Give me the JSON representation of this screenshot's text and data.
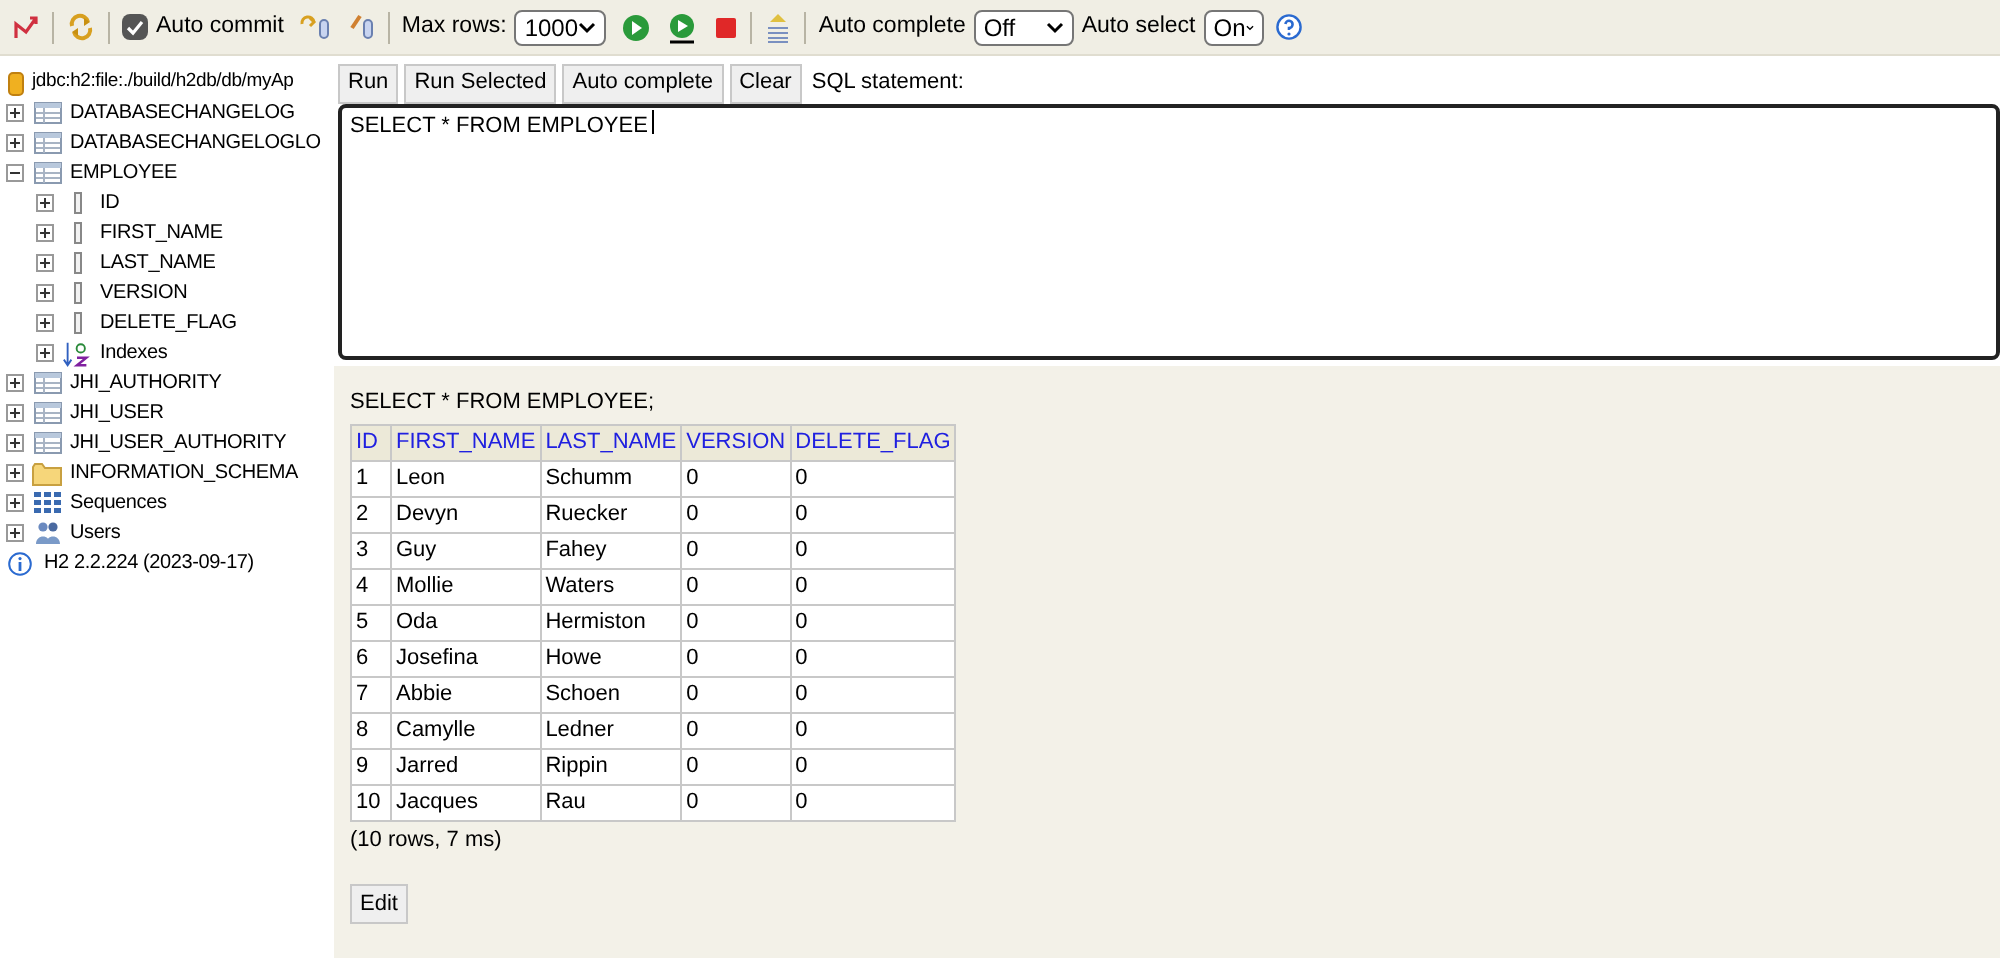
{
  "toolbar": {
    "auto_commit": {
      "label": "Auto commit",
      "checked": true
    },
    "max_rows": {
      "label": "Max rows:",
      "value": "1000"
    },
    "auto_complete": {
      "label": "Auto complete",
      "value": "Off"
    },
    "auto_select": {
      "label": "Auto select",
      "value": "On"
    }
  },
  "tree": {
    "connection": "jdbc:h2:file:./build/h2db/db/myAp",
    "items": [
      {
        "kind": "table",
        "label": "DATABASECHANGELOG",
        "expanded": false
      },
      {
        "kind": "table",
        "label": "DATABASECHANGELOGLO",
        "expanded": false
      },
      {
        "kind": "table",
        "label": "EMPLOYEE",
        "expanded": true,
        "children": [
          {
            "kind": "column",
            "label": "ID",
            "expanded": false
          },
          {
            "kind": "column",
            "label": "FIRST_NAME",
            "expanded": false
          },
          {
            "kind": "column",
            "label": "LAST_NAME",
            "expanded": false
          },
          {
            "kind": "column",
            "label": "VERSION",
            "expanded": false
          },
          {
            "kind": "column",
            "label": "DELETE_FLAG",
            "expanded": false
          },
          {
            "kind": "index",
            "label": "Indexes",
            "expanded": false
          }
        ]
      },
      {
        "kind": "table",
        "label": "JHI_AUTHORITY",
        "expanded": false
      },
      {
        "kind": "table",
        "label": "JHI_USER",
        "expanded": false
      },
      {
        "kind": "table",
        "label": "JHI_USER_AUTHORITY",
        "expanded": false
      },
      {
        "kind": "folder",
        "label": "INFORMATION_SCHEMA",
        "expanded": false
      },
      {
        "kind": "sequence",
        "label": "Sequences",
        "expanded": false
      },
      {
        "kind": "users",
        "label": "Users",
        "expanded": false
      }
    ],
    "version": "H2 2.2.224 (2023-09-17)"
  },
  "sql_buttons": [
    "Run",
    "Run Selected",
    "Auto complete",
    "Clear"
  ],
  "sql_label": "SQL statement:",
  "sql_text": "SELECT * FROM EMPLOYEE",
  "result": {
    "statement": "SELECT * FROM EMPLOYEE;",
    "columns": [
      "ID",
      "FIRST_NAME",
      "LAST_NAME",
      "VERSION",
      "DELETE_FLAG"
    ],
    "rows": [
      [
        "1",
        "Leon",
        "Schumm",
        "0",
        "0"
      ],
      [
        "2",
        "Devyn",
        "Ruecker",
        "0",
        "0"
      ],
      [
        "3",
        "Guy",
        "Fahey",
        "0",
        "0"
      ],
      [
        "4",
        "Mollie",
        "Waters",
        "0",
        "0"
      ],
      [
        "5",
        "Oda",
        "Hermiston",
        "0",
        "0"
      ],
      [
        "6",
        "Josefina",
        "Howe",
        "0",
        "0"
      ],
      [
        "7",
        "Abbie",
        "Schoen",
        "0",
        "0"
      ],
      [
        "8",
        "Camylle",
        "Ledner",
        "0",
        "0"
      ],
      [
        "9",
        "Jarred",
        "Rippin",
        "0",
        "0"
      ],
      [
        "10",
        "Jacques",
        "Rau",
        "0",
        "0"
      ]
    ],
    "summary": "(10 rows, 7 ms)",
    "edit_button": "Edit"
  }
}
